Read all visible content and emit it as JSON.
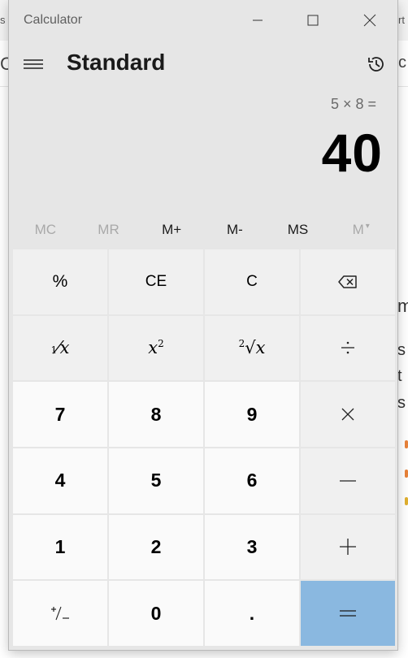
{
  "background": {
    "left_tab_fragment": "s",
    "right_tab_fragment": "rt",
    "right_glyph": "c",
    "side_text": [
      "m",
      "s",
      "t",
      "s"
    ],
    "accent_colors": [
      "#e8823a",
      "#e8823a",
      "#e0b030"
    ]
  },
  "window": {
    "title": "Calculator"
  },
  "header": {
    "mode": "Standard"
  },
  "display": {
    "expression": "5 × 8 =",
    "value": "40"
  },
  "memory": {
    "mc": "MC",
    "mr": "MR",
    "mplus": "M+",
    "mminus": "M-",
    "ms": "MS",
    "mlist": "M"
  },
  "keys": {
    "percent": "%",
    "ce": "CE",
    "c": "C",
    "seven": "7",
    "eight": "8",
    "nine": "9",
    "four": "4",
    "five": "5",
    "six": "6",
    "one": "1",
    "two": "2",
    "three": "3",
    "zero": "0",
    "decimal": ".",
    "sqrt_index": "2",
    "square_exp": "2"
  },
  "colors": {
    "equals_bg": "#8ab8e0",
    "window_bg": "#e6e6e6",
    "digit_bg": "#fafafa",
    "op_bg": "#f0f0f0"
  }
}
